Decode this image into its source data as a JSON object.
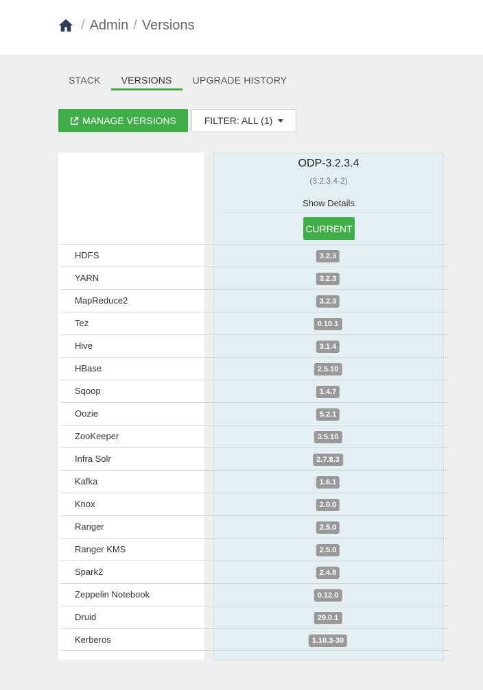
{
  "breadcrumb": {
    "items": [
      "Admin",
      "Versions"
    ],
    "separator": "/"
  },
  "tabs": [
    {
      "label": "STACK",
      "active": false
    },
    {
      "label": "VERSIONS",
      "active": true
    },
    {
      "label": "UPGRADE HISTORY",
      "active": false
    }
  ],
  "toolbar": {
    "manage_label": "MANAGE VERSIONS",
    "filter_label": "FILTER: ALL (1)"
  },
  "version": {
    "name": "ODP-3.2.3.4",
    "build": "(3.2.3.4-2)",
    "details_label": "Show Details",
    "status_label": "CURRENT"
  },
  "services": [
    {
      "name": "HDFS",
      "version": "3.2.3"
    },
    {
      "name": "YARN",
      "version": "3.2.3"
    },
    {
      "name": "MapReduce2",
      "version": "3.2.3"
    },
    {
      "name": "Tez",
      "version": "0.10.1"
    },
    {
      "name": "Hive",
      "version": "3.1.4"
    },
    {
      "name": "HBase",
      "version": "2.5.10"
    },
    {
      "name": "Sqoop",
      "version": "1.4.7"
    },
    {
      "name": "Oozie",
      "version": "5.2.1"
    },
    {
      "name": "ZooKeeper",
      "version": "3.5.10"
    },
    {
      "name": "Infra Solr",
      "version": "2.7.8.3"
    },
    {
      "name": "Kafka",
      "version": "1.6.1"
    },
    {
      "name": "Knox",
      "version": "2.0.0"
    },
    {
      "name": "Ranger",
      "version": "2.5.0"
    },
    {
      "name": "Ranger KMS",
      "version": "2.5.0"
    },
    {
      "name": "Spark2",
      "version": "2.4.8"
    },
    {
      "name": "Zeppelin Notebook",
      "version": "0.12.0"
    },
    {
      "name": "Druid",
      "version": "29.0.1"
    },
    {
      "name": "Kerberos",
      "version": "1.10.3-30"
    }
  ],
  "colors": {
    "accent": "#3fae49",
    "badge": "#999999",
    "version_bg": "#e4eff4"
  }
}
